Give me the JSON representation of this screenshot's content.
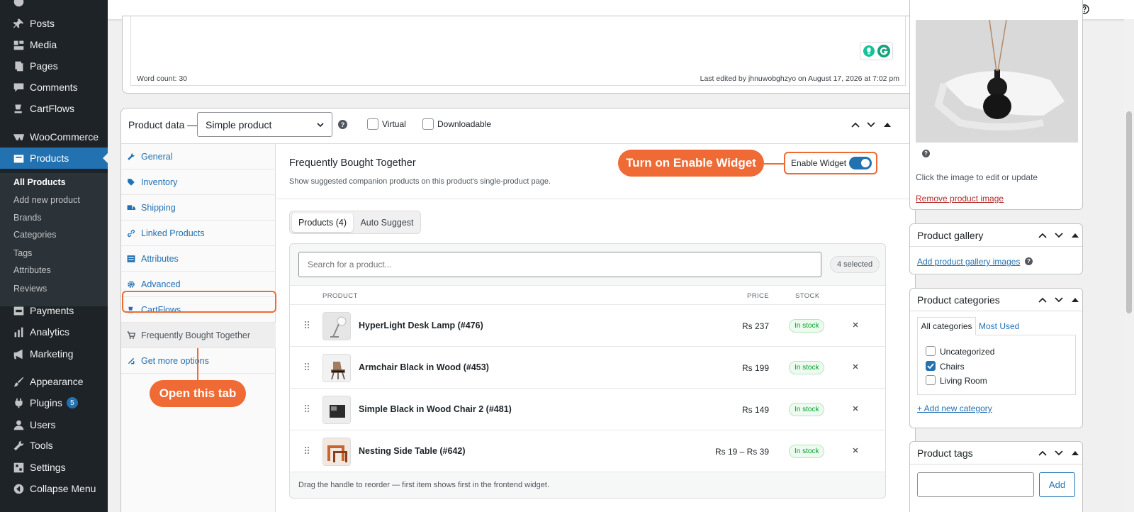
{
  "sidebar": {
    "items": [
      {
        "label": "Posts",
        "icon": "pin-icon"
      },
      {
        "label": "Media",
        "icon": "media-icon"
      },
      {
        "label": "Pages",
        "icon": "pages-icon"
      },
      {
        "label": "Comments",
        "icon": "comment-icon"
      },
      {
        "label": "CartFlows",
        "icon": "cartflows-icon"
      },
      {
        "label": "WooCommerce",
        "icon": "woo-icon"
      },
      {
        "label": "Products",
        "icon": "products-icon"
      },
      {
        "label": "Payments",
        "icon": "payments-icon"
      },
      {
        "label": "Analytics",
        "icon": "analytics-icon"
      },
      {
        "label": "Marketing",
        "icon": "megaphone-icon"
      },
      {
        "label": "Appearance",
        "icon": "brush-icon"
      },
      {
        "label": "Plugins",
        "icon": "plug-icon",
        "badge": "5"
      },
      {
        "label": "Users",
        "icon": "user-icon"
      },
      {
        "label": "Tools",
        "icon": "wrench-icon"
      },
      {
        "label": "Settings",
        "icon": "settings-icon"
      },
      {
        "label": "Collapse Menu",
        "icon": "collapse-icon"
      }
    ],
    "submenu": [
      "All Products",
      "Add new product",
      "Brands",
      "Categories",
      "Tags",
      "Attributes",
      "Reviews"
    ]
  },
  "editor": {
    "word_count": "Word count: 30",
    "last_edited": "Last edited by jhnuwobghzyo on August 17, 2026 at 7:02 pm"
  },
  "product_data": {
    "title": "Product data —",
    "type_selected": "Simple product",
    "virtual_label": "Virtual",
    "downloadable_label": "Downloadable",
    "tabs": [
      {
        "label": "General",
        "icon": "wrench-icon"
      },
      {
        "label": "Inventory",
        "icon": "tag-icon"
      },
      {
        "label": "Shipping",
        "icon": "truck-icon"
      },
      {
        "label": "Linked Products",
        "icon": "link-icon"
      },
      {
        "label": "Attributes",
        "icon": "list-icon"
      },
      {
        "label": "Advanced",
        "icon": "gear-icon"
      },
      {
        "label": "CartFlows",
        "icon": "cartflows-icon"
      },
      {
        "label": "Frequently Bought Together",
        "icon": "cart-icon"
      },
      {
        "label": "Get more options",
        "icon": "plugin-icon"
      }
    ]
  },
  "fbt": {
    "title": "Frequently Bought Together",
    "description": "Show suggested companion products on this product's single-product page.",
    "enable_label": "Enable Widget",
    "enabled": true,
    "seg_products": "Products (4)",
    "seg_auto": "Auto Suggest",
    "search_placeholder": "Search for a product...",
    "selected_count": "4 selected",
    "headers": {
      "product": "PRODUCT",
      "price": "PRICE",
      "stock": "STOCK"
    },
    "rows": [
      {
        "name": "HyperLight Desk Lamp (#476)",
        "price": "Rs 237",
        "stock": "In stock"
      },
      {
        "name": "Armchair Black in Wood (#453)",
        "price": "Rs 199",
        "stock": "In stock"
      },
      {
        "name": "Simple Black in Wood Chair 2 (#481)",
        "price": "Rs 149",
        "stock": "In stock"
      },
      {
        "name": "Nesting Side Table (#642)",
        "price": "Rs 19 – Rs 39",
        "stock": "In stock"
      }
    ],
    "hint": "Drag the handle to reorder — first item shows first in the frontend widget."
  },
  "callouts": {
    "enable": "Turn on Enable Widget",
    "tab": "Open this tab"
  },
  "product_image": {
    "hint": "Click the image to edit or update",
    "remove": "Remove product image"
  },
  "gallery": {
    "title": "Product gallery",
    "add": "Add product gallery images"
  },
  "categories": {
    "title": "Product categories",
    "tab_all": "All categories",
    "tab_used": "Most Used",
    "items": [
      {
        "label": "Uncategorized",
        "checked": false
      },
      {
        "label": "Chairs",
        "checked": true
      },
      {
        "label": "Living Room",
        "checked": false
      }
    ],
    "add": "+ Add new category"
  },
  "tags": {
    "title": "Product tags",
    "add_button": "Add"
  },
  "colors": {
    "accent": "#2271b1",
    "callout": "#ef6a35",
    "sidebar": "#1d2327",
    "stock_green": "#00a32a"
  }
}
